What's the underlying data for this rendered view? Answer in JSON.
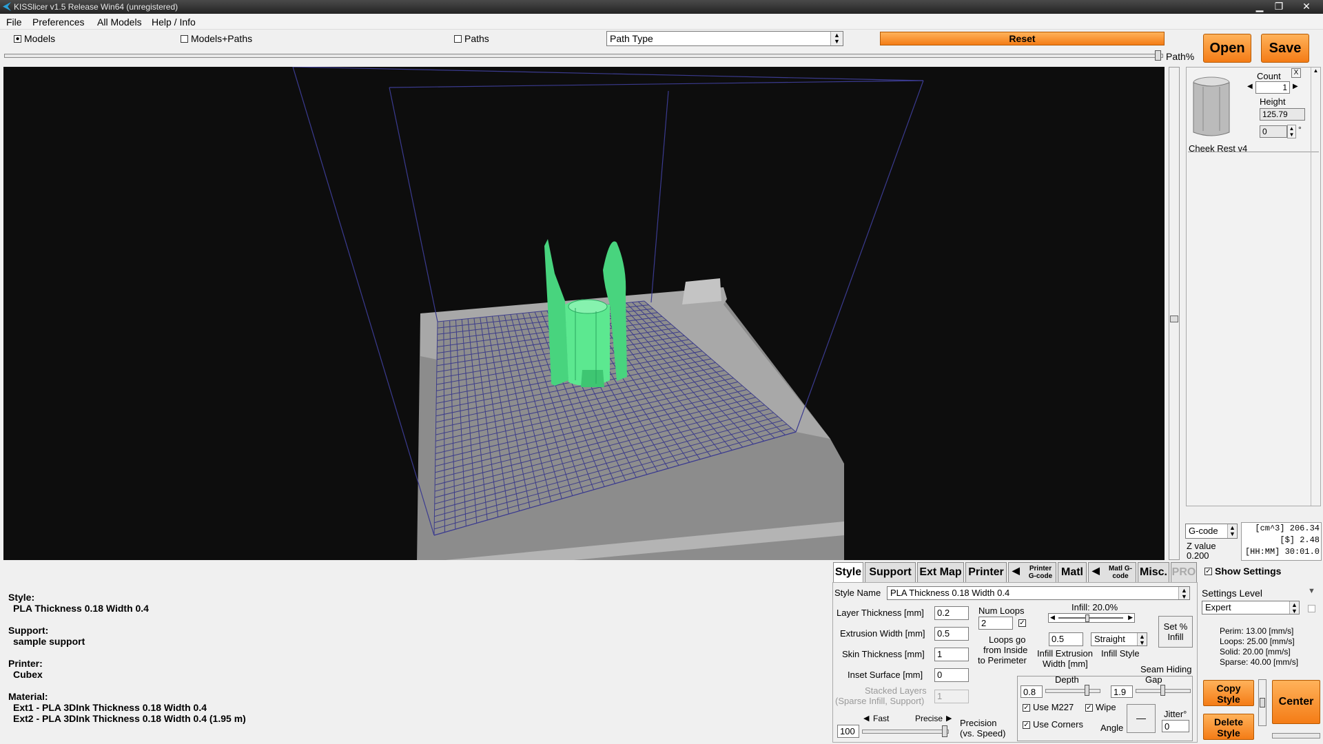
{
  "window": {
    "title": "KISSlicer v1.5 Release Win64 (unregistered)"
  },
  "menu": [
    "File",
    "Preferences",
    "All Models",
    "Help / Info"
  ],
  "view": {
    "models": "Models",
    "models_paths": "Models+Paths",
    "paths": "Paths",
    "path_type": "Path Type",
    "reset": "Reset",
    "path_pct": "Path%",
    "open": "Open",
    "save": "Save"
  },
  "model": {
    "count_label": "Count",
    "count": "1",
    "height_label": "Height",
    "height": "125.79",
    "rotation": "0",
    "deg": "°",
    "name": "Cheek Rest v4",
    "close": "X"
  },
  "stats": {
    "format": "G-code",
    "z_label": "Z value",
    "z_value": "0.200",
    "lines": [
      "[cm^3] 206.34",
      "[$] 2.48",
      "[HH:MM] 30:01.0"
    ]
  },
  "info": {
    "style_h": "Style:",
    "style_v": "PLA Thickness 0.18 Width 0.4",
    "support_h": "Support:",
    "support_v": "sample support",
    "printer_h": "Printer:",
    "printer_v": "Cubex",
    "material_h": "Material:",
    "ext1": "Ext1 - PLA 3DInk Thickness 0.18 Width 0.4",
    "ext2": "Ext2 - PLA 3DInk Thickness 0.18 Width 0.4 (1.95 m)"
  },
  "tabs": [
    {
      "label": "Style"
    },
    {
      "label": "Support"
    },
    {
      "label": "Ext Map"
    },
    {
      "label": "Printer"
    },
    {
      "label": "Printer G-code"
    },
    {
      "label": "Matl"
    },
    {
      "label": "Matl G-code"
    },
    {
      "label": "Misc."
    },
    {
      "label": "PRO"
    }
  ],
  "style": {
    "name_label": "Style Name",
    "name": "PLA Thickness 0.18 Width 0.4",
    "layer_label": "Layer Thickness [mm]",
    "layer": "0.2",
    "extr_label": "Extrusion Width [mm]",
    "extr": "0.5",
    "skin_label": "Skin Thickness [mm]",
    "skin": "1",
    "inset_label": "Inset  Surface [mm]",
    "inset": "0",
    "stacked_label1": "Stacked Layers",
    "stacked_label2": "(Sparse Infill, Support)",
    "stacked": "1",
    "loops_label": "Num Loops",
    "loops": "2",
    "loops_go1": "Loops go",
    "loops_go2": "from Inside",
    "loops_go3": "to Perimeter",
    "infill_label": "Infill: 20.0%",
    "infill_pct": 20,
    "infill_width": "0.5",
    "infill_style": "Straight",
    "infill_w_label1": "Infill Extrusion",
    "infill_w_label2": "Width [mm]",
    "infill_style_label": "Infill Style",
    "set_infill1": "Set %",
    "set_infill2": "Infill",
    "seam_label": "Seam Hiding",
    "depth_label": "Depth",
    "gap_label": "Gap",
    "depth": "0.8",
    "gap": "1.9",
    "m227": "Use M227",
    "wipe": "Wipe",
    "corners": "Use Corners",
    "angle_label": "Angle",
    "jitter_label": "Jitter°",
    "jitter": "0",
    "fast": "Fast",
    "precise": "Precise",
    "precision": "100",
    "precision_label1": "Precision",
    "precision_label2": "(vs. Speed)"
  },
  "settings": {
    "show": "Show Settings",
    "level_label": "Settings Level",
    "level": "Expert",
    "speeds": [
      "Perim:  13.00 [mm/s]",
      "Loops:  25.00 [mm/s]",
      "Solid:  20.00 [mm/s]",
      "Sparse: 40.00 [mm/s]"
    ],
    "copy1": "Copy",
    "copy2": "Style",
    "delete1": "Delete",
    "delete2": "Style",
    "center": "Center"
  },
  "colors": {
    "model": "#5ce890",
    "accent": "#f58a22",
    "bed": "#8c8c8c",
    "grid": "#3d3d8a"
  }
}
